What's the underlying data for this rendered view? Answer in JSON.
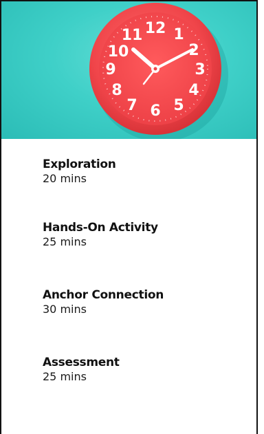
{
  "hero": {
    "icon": "clock-icon",
    "background_color": "#3fd0c8",
    "clock_color": "#f0454a"
  },
  "agenda": {
    "items": [
      {
        "title": "Exploration",
        "duration": "20 mins"
      },
      {
        "title": "Hands-On Activity",
        "duration": "25 mins"
      },
      {
        "title": "Anchor Connection",
        "duration": "30 mins"
      },
      {
        "title": "Assessment",
        "duration": "25 mins"
      }
    ]
  }
}
